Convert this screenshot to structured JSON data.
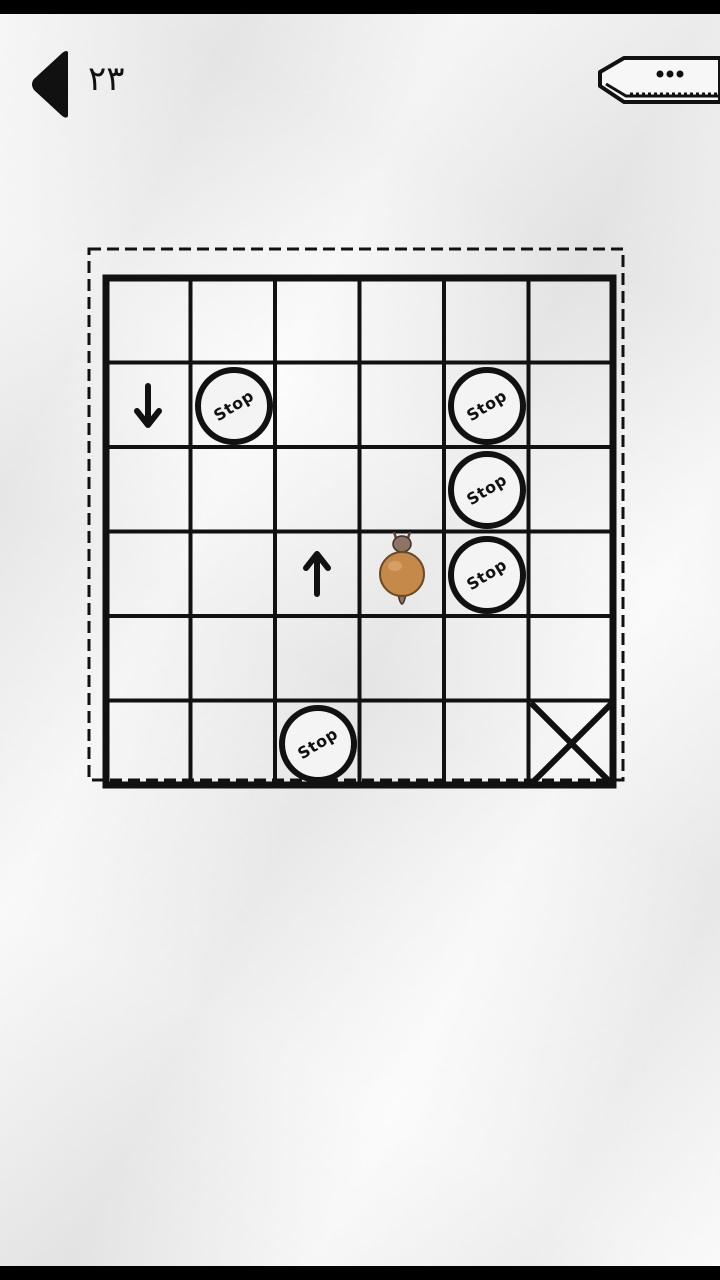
{
  "header": {
    "level_number": "۲۳",
    "back_icon": "triangle-left-icon",
    "menu_icon": "pencil-menu-icon"
  },
  "board": {
    "rows": 6,
    "cols": 6,
    "pieces": [
      {
        "type": "arrow",
        "direction": "down",
        "row": 1,
        "col": 0
      },
      {
        "type": "stop",
        "label": "Stop",
        "row": 1,
        "col": 1
      },
      {
        "type": "stop",
        "label": "Stop",
        "row": 1,
        "col": 4
      },
      {
        "type": "stop",
        "label": "Stop",
        "row": 2,
        "col": 4
      },
      {
        "type": "arrow",
        "direction": "up",
        "row": 3,
        "col": 2
      },
      {
        "type": "player",
        "row": 3,
        "col": 3
      },
      {
        "type": "stop",
        "label": "Stop",
        "row": 3,
        "col": 4
      },
      {
        "type": "stop",
        "label": "Stop",
        "row": 5,
        "col": 2
      },
      {
        "type": "goal",
        "row": 5,
        "col": 5
      }
    ]
  },
  "colors": {
    "ink": "#111111",
    "player_body": "#c58a4a",
    "player_head": "#8c7363"
  }
}
